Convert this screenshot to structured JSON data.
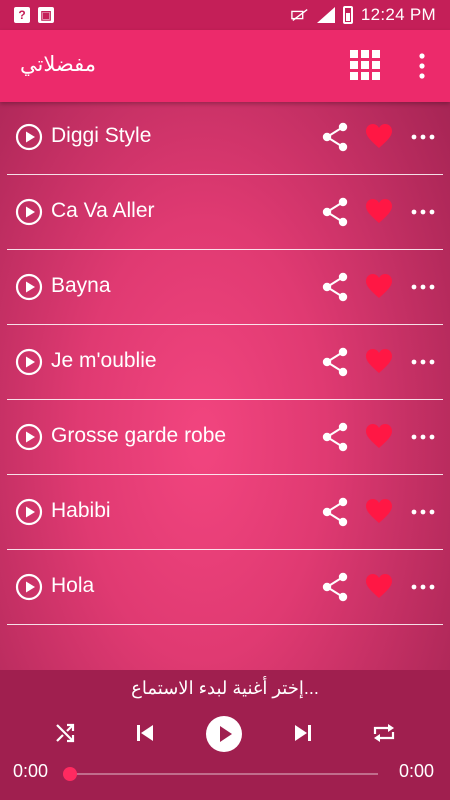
{
  "status_bar": {
    "time": "12:24 PM",
    "icons": [
      "help-notification-icon",
      "image-notification-icon",
      "mute-icon",
      "signal-icon",
      "battery-icon"
    ]
  },
  "app_bar": {
    "title": "مفضلاتي",
    "icons": [
      "grid-icon",
      "more-vert-icon"
    ]
  },
  "songs": [
    {
      "title": "Diggi Style"
    },
    {
      "title": "Ca Va Aller"
    },
    {
      "title": "Bayna"
    },
    {
      "title": "Je m'oublie"
    },
    {
      "title": "Grosse garde robe"
    },
    {
      "title": "Habibi"
    },
    {
      "title": "Hola"
    }
  ],
  "player": {
    "prompt": "إختر أغنية لبدء الاستماع...",
    "time_elapsed": "0:00",
    "time_total": "0:00",
    "progress": 0
  },
  "colors": {
    "accent": "#ec2a6b",
    "heart": "#ff1744",
    "player_bg": "#a01f4f"
  }
}
